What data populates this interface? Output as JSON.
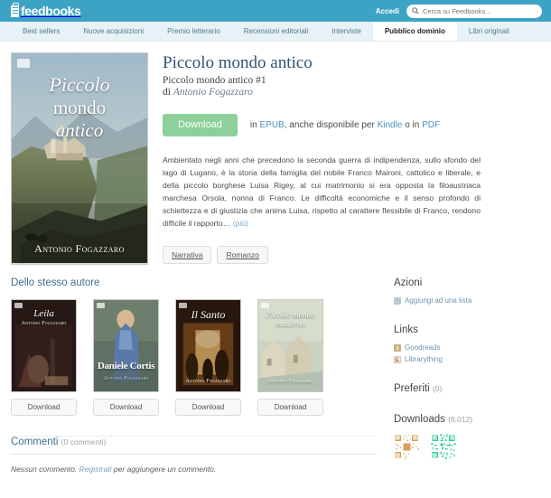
{
  "header": {
    "logo_text": "feedbooks",
    "logo_icon": "book-icon",
    "login_label": "Accedi",
    "search_placeholder": "Cerca su Feedbooks...",
    "search_value": "",
    "search_icon": "search-icon",
    "brand_color": "#3da3c4"
  },
  "nav": {
    "items": [
      {
        "label": "Best sellers",
        "active": false
      },
      {
        "label": "Nuove acquisizioni",
        "active": false
      },
      {
        "label": "Premio letterario",
        "active": false
      },
      {
        "label": "Recensioni editoriali",
        "active": false
      },
      {
        "label": "Interviste",
        "active": false
      },
      {
        "label": "Pubblico dominio",
        "active": true
      },
      {
        "label": "Libri originali",
        "active": false
      }
    ]
  },
  "book": {
    "title": "Piccolo mondo antico",
    "series": "Piccolo mondo antico #1",
    "by_prefix": "di",
    "author": "Antonio Fogazzaro",
    "cover": {
      "title_line1": "Piccolo",
      "title_line2": "mondo",
      "title_line3": "antico",
      "author": "Antonio Fogazzaro",
      "badge": "feedbooks-logo-icon"
    },
    "download_label": "Download",
    "download_color": "#8dd09a",
    "formats_prefix": "in",
    "format_primary": "EPUB",
    "formats_middle": ", anche disponibile per",
    "format_kindle": "Kindle",
    "formats_or": "o in",
    "format_pdf": "PDF",
    "description": "Ambientato negli anni che precedono la seconda guerra di indipendenza, sullo sfondo del lago di Lugano, è la storia della famiglia del nobile Franco Maironi, cattolico e liberale, e della piccolo borghese Luisa Rigey, al cui matrimonio si era opposta la filoaustriaca marchesa Orsola, nonna di Franco. Le difficoltà economiche e il senso profondo di schiettezza e di giustizia che anima Luisa, rispetto al carattere flessibile di Franco, rendono difficile il rapporto… ",
    "description_more": "(più)",
    "tags": [
      "Narrativa",
      "Romanzo"
    ]
  },
  "same_author": {
    "heading": "Dello stesso autore",
    "books": [
      {
        "title": "Leila",
        "author": "Antonio Fogazzaro",
        "download_label": "Download"
      },
      {
        "title": "Daniele Cortis",
        "author": "Antonio Fogazzaro",
        "download_label": "Download"
      },
      {
        "title": "Il Santo",
        "author": "Antonio Fogazzaro",
        "download_label": "Download"
      },
      {
        "title": "Piccolo mondo moderno",
        "author": "Antonio Fogazzaro",
        "download_label": "Download"
      }
    ]
  },
  "comments": {
    "heading": "Commenti",
    "count_label": "(0 commenti)",
    "empty_prefix": "Nessun commento. ",
    "empty_link": "Registrati",
    "empty_suffix": " per aggiungere un commento."
  },
  "sidebar": {
    "actions": {
      "heading": "Azioni",
      "add_to_list": "Aggiungi ad una lista",
      "add_to_list_icon": "list-icon"
    },
    "links": {
      "heading": "Links",
      "items": [
        {
          "label": "Goodreads",
          "icon": "goodreads-icon"
        },
        {
          "label": "Librarything",
          "icon": "librarything-icon"
        }
      ]
    },
    "favorites": {
      "heading": "Preferiti",
      "count_label": "(0)"
    },
    "downloads": {
      "heading": "Downloads",
      "count_label": "(8,012)",
      "qr_codes": [
        {
          "name": "qr-code-orange",
          "color": "#d9a05b"
        },
        {
          "name": "qr-code-green",
          "color": "#2ecc9b"
        }
      ]
    }
  }
}
